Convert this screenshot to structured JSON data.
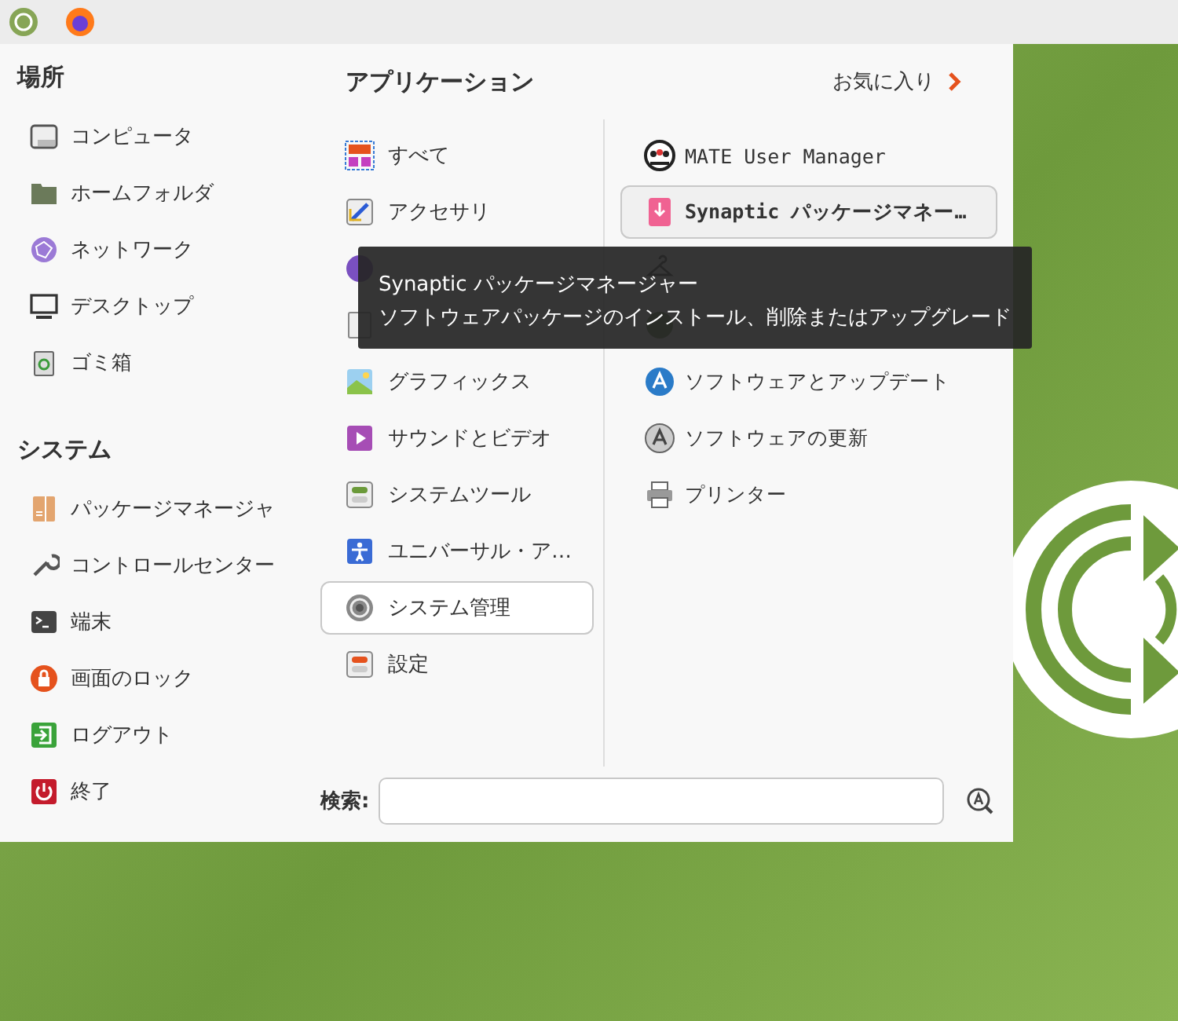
{
  "panel": {
    "launchers": [
      {
        "kind": "launcher"
      },
      {
        "kind": "launcher"
      }
    ]
  },
  "places": {
    "title": "場所",
    "items": [
      {
        "label": "コンピュータ"
      },
      {
        "label": "ホームフォルダ"
      },
      {
        "label": "ネットワーク"
      },
      {
        "label": "デスクトップ"
      },
      {
        "label": "ゴミ箱"
      }
    ]
  },
  "system": {
    "title": "システム",
    "items": [
      {
        "label": "パッケージマネージャ"
      },
      {
        "label": "コントロールセンター"
      },
      {
        "label": "端末"
      },
      {
        "label": "画面のロック"
      },
      {
        "label": "ログアウト"
      },
      {
        "label": "終了"
      }
    ]
  },
  "applications": {
    "title": "アプリケーション",
    "favorites_link": "お気に入り",
    "categories": [
      {
        "label": "すべて",
        "selected": false
      },
      {
        "label": "アクセサリ",
        "selected": false
      },
      {
        "selected": false
      },
      {
        "selected": false
      },
      {
        "label": "グラフィックス",
        "selected": false
      },
      {
        "label": "サウンドとビデオ",
        "selected": false
      },
      {
        "label": "システムツール",
        "selected": false
      },
      {
        "label": "ユニバーサル・ア…",
        "selected": false
      },
      {
        "label": "システム管理",
        "selected": true
      },
      {
        "label": "設定",
        "selected": false
      }
    ],
    "apps": [
      {
        "label": "MATE User Manager",
        "selected": false
      },
      {
        "label": "Synaptic パッケージマネー…",
        "selected": true
      },
      {
        "selected": false
      },
      {
        "selected": false
      },
      {
        "label": "ソフトウェアとアップデート",
        "selected": false
      },
      {
        "label": "ソフトウェアの更新",
        "selected": false
      },
      {
        "label": "プリンター",
        "selected": false
      }
    ]
  },
  "search": {
    "label": "検索:"
  },
  "tooltip": {
    "title": "Synaptic パッケージマネージャー",
    "description": "ソフトウェアパッケージのインストール、削除またはアップグレード"
  }
}
